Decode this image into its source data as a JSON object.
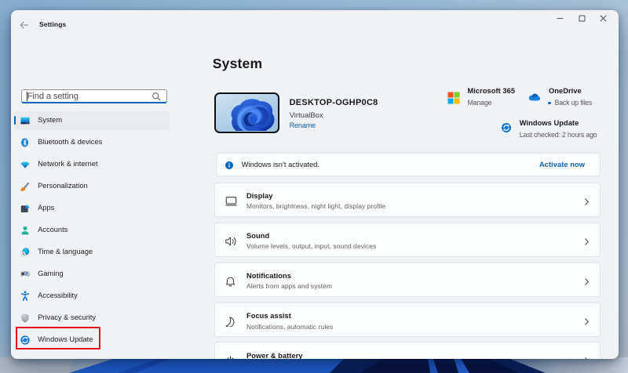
{
  "desktop": {
    "accent_blue": "#0067c0",
    "annotation_color": "#e8101c"
  },
  "titlebar": {
    "title": "Settings",
    "back_icon": "back-arrow-icon",
    "controls": [
      "minimize",
      "maximize",
      "close"
    ]
  },
  "sidebar": {
    "search": {
      "placeholder": "Find a setting",
      "icon": "search-icon"
    },
    "items": [
      {
        "label": "System",
        "icon": "system-icon",
        "selected": true
      },
      {
        "label": "Bluetooth & devices",
        "icon": "bluetooth-icon"
      },
      {
        "label": "Network & internet",
        "icon": "network-icon"
      },
      {
        "label": "Personalization",
        "icon": "personalization-icon"
      },
      {
        "label": "Apps",
        "icon": "apps-icon"
      },
      {
        "label": "Accounts",
        "icon": "accounts-icon"
      },
      {
        "label": "Time & language",
        "icon": "time-language-icon"
      },
      {
        "label": "Gaming",
        "icon": "gaming-icon"
      },
      {
        "label": "Accessibility",
        "icon": "accessibility-icon"
      },
      {
        "label": "Privacy & security",
        "icon": "privacy-security-icon"
      },
      {
        "label": "Windows Update",
        "icon": "windows-update-icon",
        "annotated": true
      }
    ]
  },
  "main": {
    "page_title": "System",
    "device": {
      "name": "DESKTOP-OGHP0C8",
      "model": "VirtualBox",
      "rename_label": "Rename"
    },
    "quick_links": [
      {
        "title": "Microsoft 365",
        "subtitle": "Manage",
        "icon": "microsoft-365-icon"
      },
      {
        "title": "OneDrive",
        "subtitle": "Back up files",
        "icon": "onedrive-icon"
      },
      {
        "title": "Windows Update",
        "subtitle": "Last checked: 2 hours ago",
        "icon": "windows-update-badge-icon"
      }
    ],
    "banner": {
      "text": "Windows isn’t activated.",
      "action_label": "Activate now",
      "icon": "info-icon"
    },
    "cards": [
      {
        "title": "Display",
        "description": "Monitors, brightness, night light, display profile",
        "icon": "display-icon"
      },
      {
        "title": "Sound",
        "description": "Volume levels, output, input, sound devices",
        "icon": "sound-icon"
      },
      {
        "title": "Notifications",
        "description": "Alerts from apps and system",
        "icon": "notifications-icon"
      },
      {
        "title": "Focus assist",
        "description": "Notifications, automatic rules",
        "icon": "focus-assist-icon"
      },
      {
        "title": "Power & battery",
        "description": "",
        "icon": "power-battery-icon"
      }
    ]
  }
}
